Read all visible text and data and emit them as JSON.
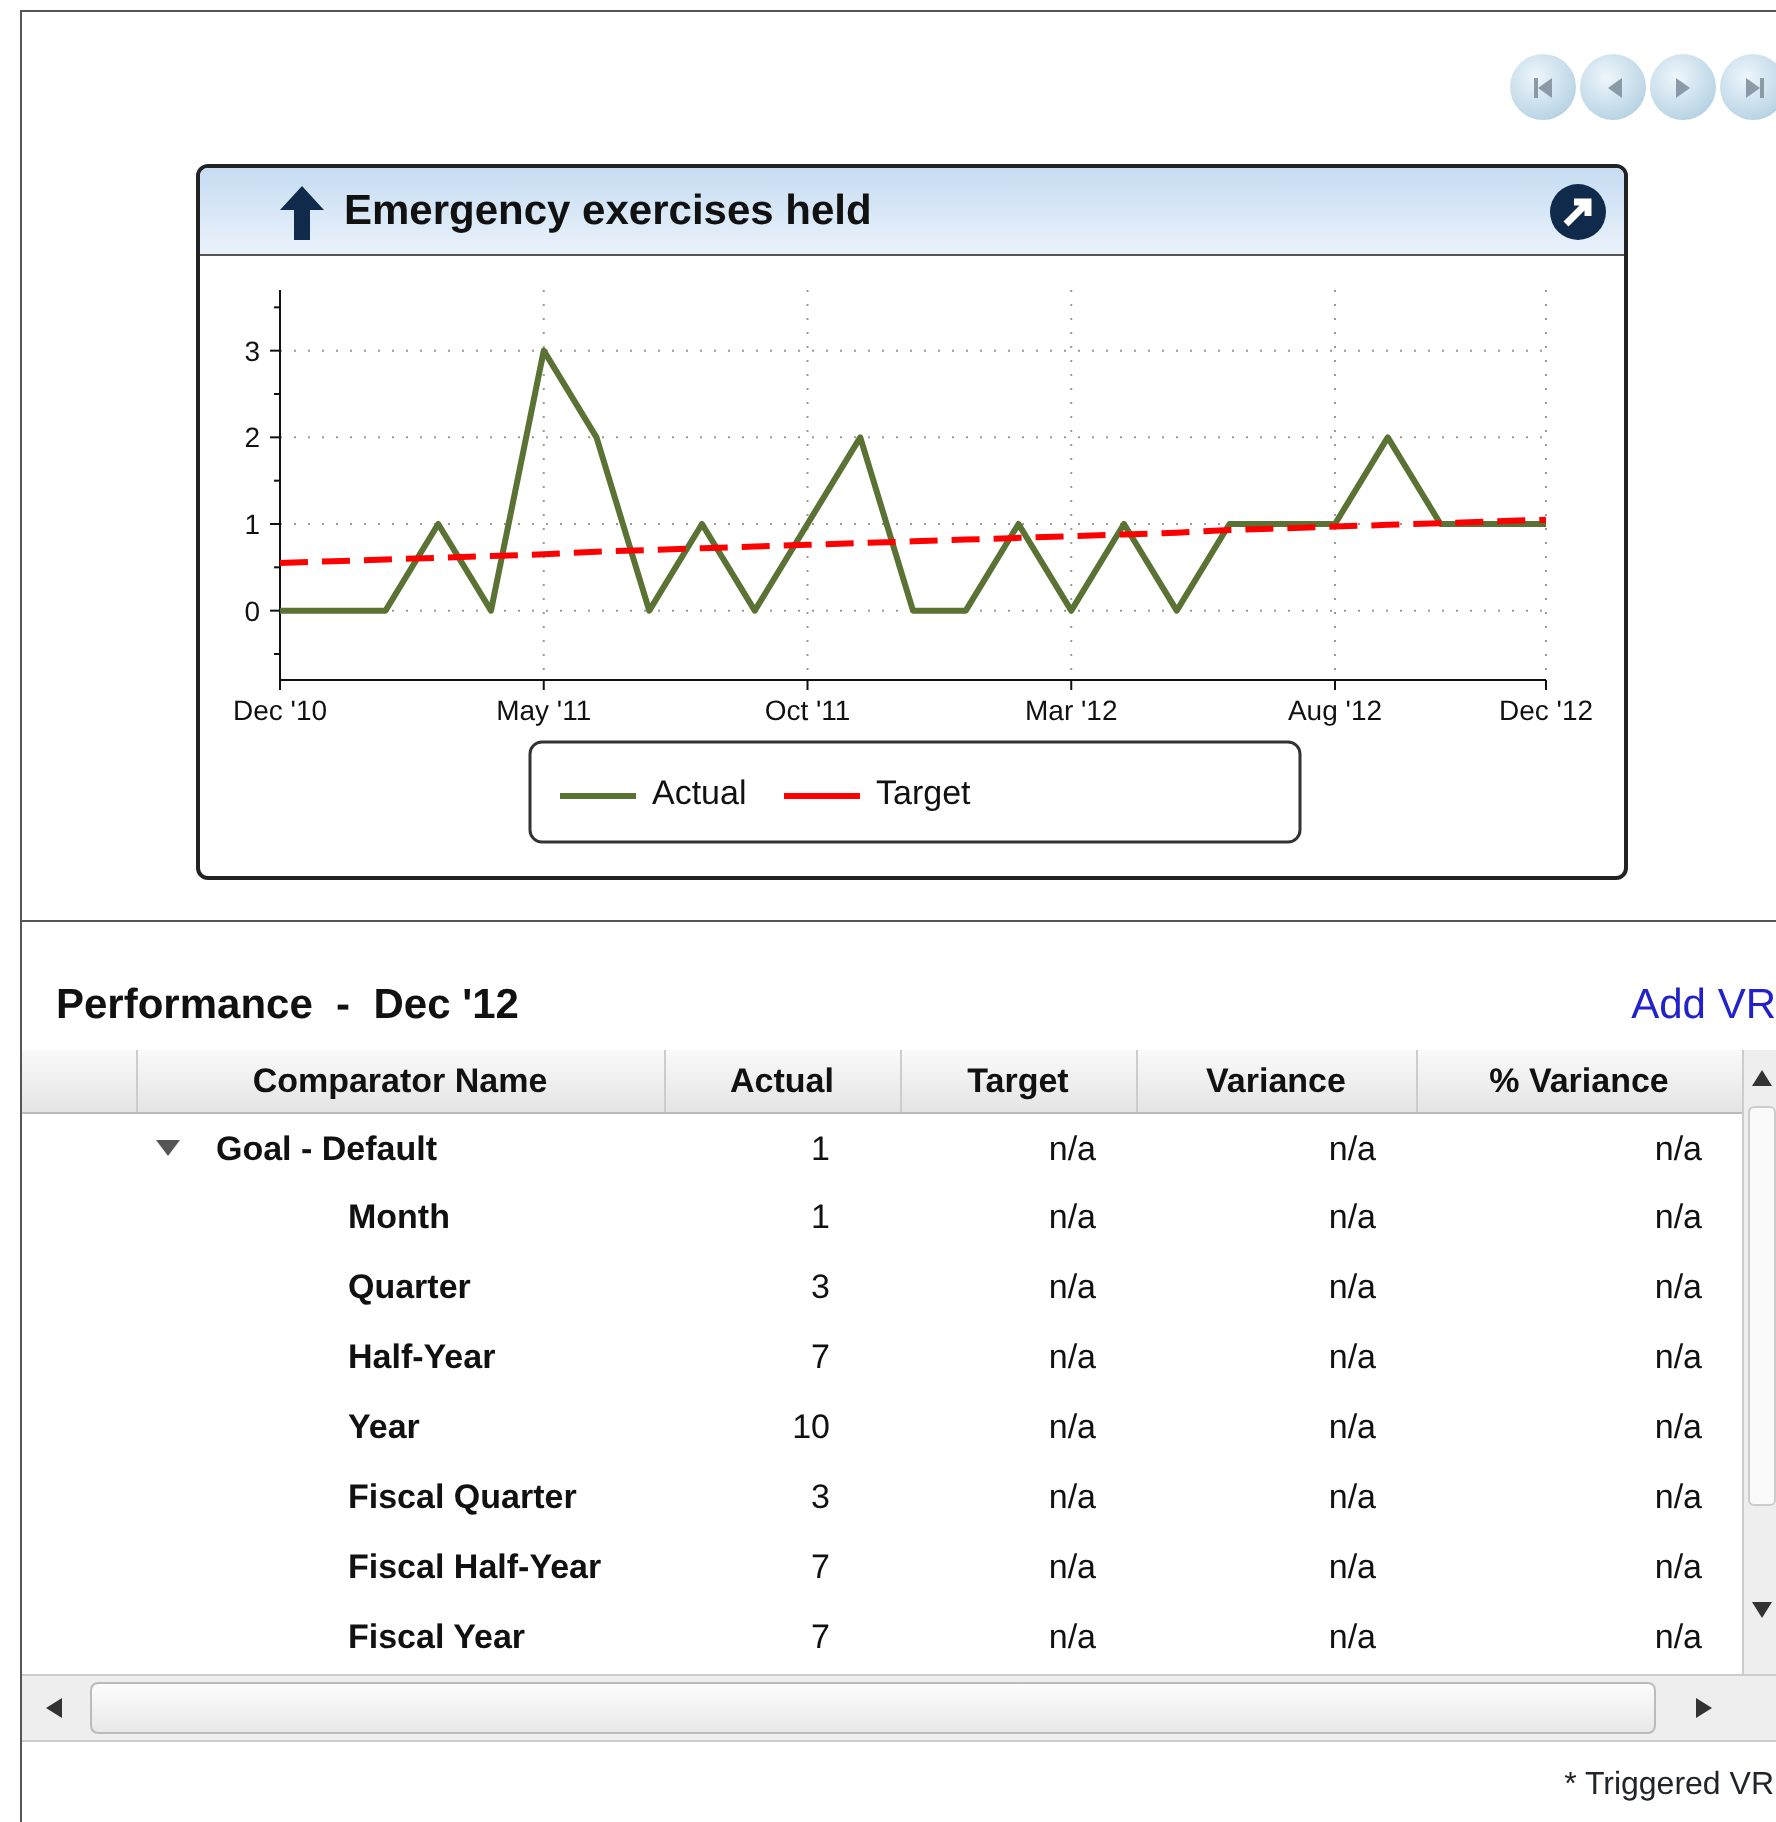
{
  "chart_panel": {
    "title": "Emergency exercises held",
    "chart_data": {
      "type": "line",
      "categories": [
        "Dec '10",
        null,
        null,
        null,
        null,
        "May '11",
        null,
        null,
        null,
        null,
        "Oct '11",
        null,
        null,
        null,
        null,
        "Mar '12",
        null,
        null,
        null,
        null,
        "Aug '12",
        null,
        null,
        null,
        "Dec '12"
      ],
      "ylim": [
        -0.8,
        3.7
      ],
      "grid": true,
      "legend": "bottom",
      "yticks": [
        0,
        1,
        2,
        3
      ],
      "series": [
        {
          "name": "Actual",
          "color": "#5a7233",
          "line_style": "solid",
          "values": [
            0,
            0,
            0,
            1,
            0,
            3,
            2,
            0,
            1,
            0,
            1,
            2,
            0,
            0,
            1,
            0,
            1,
            0,
            1,
            1,
            1,
            2,
            1,
            1,
            1
          ]
        },
        {
          "name": "Target",
          "color": "#ff0000",
          "line_style": "dashed",
          "values": [
            0.55,
            0.57,
            0.59,
            0.61,
            0.63,
            0.65,
            0.68,
            0.7,
            0.72,
            0.74,
            0.76,
            0.78,
            0.8,
            0.82,
            0.84,
            0.86,
            0.88,
            0.9,
            0.93,
            0.95,
            0.97,
            0.99,
            1.01,
            1.03,
            1.05
          ]
        }
      ]
    }
  },
  "performance": {
    "title": "Performance",
    "separator": "-",
    "period": "Dec '12",
    "add_link": "Add VR",
    "columns": [
      "Comparator Name",
      "Actual",
      "Target",
      "Variance",
      "% Variance"
    ],
    "rows": [
      {
        "name": "Goal - Default",
        "actual": "1",
        "target": "n/a",
        "variance": "n/a",
        "pct_variance": "n/a",
        "expanded": true,
        "children": [
          {
            "name": "Month",
            "actual": "1",
            "target": "n/a",
            "variance": "n/a",
            "pct_variance": "n/a"
          },
          {
            "name": "Quarter",
            "actual": "3",
            "target": "n/a",
            "variance": "n/a",
            "pct_variance": "n/a"
          },
          {
            "name": "Half-Year",
            "actual": "7",
            "target": "n/a",
            "variance": "n/a",
            "pct_variance": "n/a"
          },
          {
            "name": "Year",
            "actual": "10",
            "target": "n/a",
            "variance": "n/a",
            "pct_variance": "n/a"
          },
          {
            "name": "Fiscal Quarter",
            "actual": "3",
            "target": "n/a",
            "variance": "n/a",
            "pct_variance": "n/a"
          },
          {
            "name": "Fiscal Half-Year",
            "actual": "7",
            "target": "n/a",
            "variance": "n/a",
            "pct_variance": "n/a"
          },
          {
            "name": "Fiscal Year",
            "actual": "7",
            "target": "n/a",
            "variance": "n/a",
            "pct_variance": "n/a"
          }
        ]
      }
    ],
    "footnote": "* Triggered VR"
  }
}
